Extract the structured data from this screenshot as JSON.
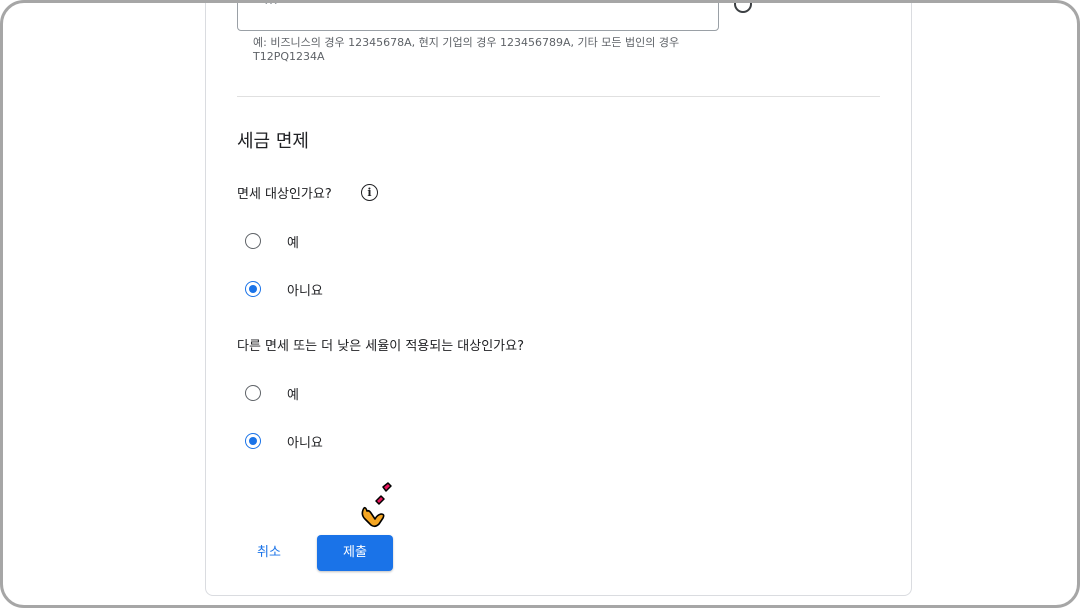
{
  "form": {
    "tax_id_field": {
      "cut_label": "…",
      "hint": "예: 비즈니스의 경우 12345678A, 현지 기업의 경우 123456789A, 기타 모든 법인의 경우 T12PQ1234A"
    },
    "section_title": "세금 면제",
    "question_1": {
      "text": "면세 대상인가요?",
      "options": [
        "예",
        "아니요"
      ],
      "selected": "아니요"
    },
    "question_2": {
      "text": "다른 면세 또는 더 낮은 세율이 적용되는 대상인가요?",
      "options": [
        "예",
        "아니요"
      ],
      "selected": "아니요"
    },
    "buttons": {
      "cancel": "취소",
      "submit": "제출"
    }
  },
  "colors": {
    "accent": "#1a73e8",
    "text": "#202124",
    "hint": "#5f6368",
    "border": "#dadce0",
    "frame": "#a6a6a6"
  },
  "icons": {
    "info": "info-icon",
    "help": "help-circle-icon",
    "pointer": "click-pointer-icon"
  }
}
